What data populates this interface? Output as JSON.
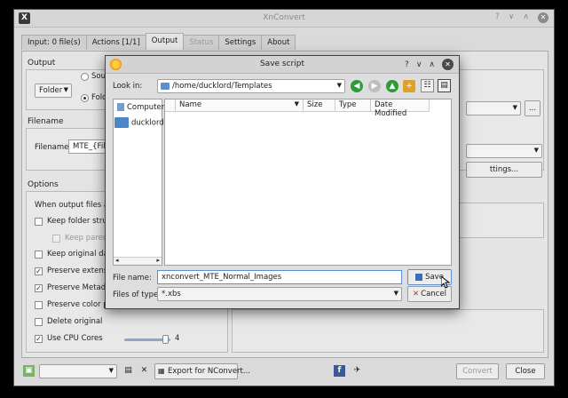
{
  "main_window": {
    "title": "XnConvert",
    "tabs": [
      {
        "label": "Input: 0 file(s)"
      },
      {
        "label": "Actions [1/1]"
      },
      {
        "label": "Output"
      },
      {
        "label": "Status"
      },
      {
        "label": "Settings"
      },
      {
        "label": "About"
      }
    ],
    "output": {
      "section_title": "Output",
      "folder_combo": "Folder",
      "radio_source": "Sou",
      "radio_folder": "Fold"
    },
    "filename": {
      "section_title": "Filename",
      "label": "Filename",
      "value": "MTE_{Filen"
    },
    "options": {
      "section_title": "Options",
      "when_exists_label": "When output files alre",
      "items": [
        {
          "label": "Keep folder structu",
          "checked": false
        },
        {
          "label": "Keep parent",
          "checked": false
        },
        {
          "label": "Keep original date",
          "checked": false
        },
        {
          "label": "Preserve extension",
          "checked": true
        },
        {
          "label": "Preserve Metadata",
          "checked": true
        },
        {
          "label": "Preserve color pro",
          "checked": false
        },
        {
          "label": "Delete original",
          "checked": false
        },
        {
          "label": "Use CPU Cores",
          "checked": true
        }
      ],
      "cpu_cores_value": "4",
      "cpu_cores_level": 0.95
    },
    "right_panel": {
      "browse_button": "...",
      "settings_button": "ttings..."
    },
    "bottom": {
      "export_button": "Export for NConvert...",
      "convert_button": "Convert",
      "close_button": "Close"
    }
  },
  "dialog": {
    "title": "Save script",
    "title_buttons": {
      "help": "?",
      "minimize": "∨",
      "maximize": "∧",
      "close": "✕"
    },
    "look_in_label": "Look in:",
    "look_in_path": "/home/ducklord/Templates",
    "sidebar": [
      {
        "label": "Computer"
      },
      {
        "label": "ducklord"
      }
    ],
    "columns": [
      {
        "label": "Name"
      },
      {
        "label": "Size"
      },
      {
        "label": "Type"
      },
      {
        "label": "Date Modified"
      }
    ],
    "file_name_label": "File name:",
    "file_name_value": "xnconvert_MTE_Normal_Images",
    "files_of_type_label": "Files of type:",
    "files_of_type_value": "*.xbs",
    "save_button": "Save",
    "cancel_button": "Cancel"
  }
}
